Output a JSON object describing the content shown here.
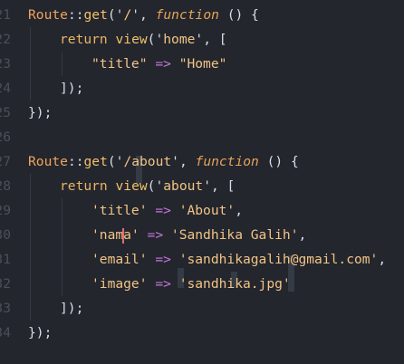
{
  "editor": {
    "lines": [
      {
        "number": "21",
        "tokens": [
          {
            "t": "Route",
            "c": "class"
          },
          {
            "t": "::",
            "c": "punc"
          },
          {
            "t": "get",
            "c": "fn"
          },
          {
            "t": "('",
            "c": "punc"
          },
          {
            "t": "/",
            "c": "str"
          },
          {
            "t": "', ",
            "c": "punc"
          },
          {
            "t": "function",
            "c": "kw"
          },
          {
            "t": " () {",
            "c": "punc"
          }
        ]
      },
      {
        "number": "22",
        "indent": 1,
        "tokens": [
          {
            "t": "return",
            "c": "ret"
          },
          {
            "t": " ",
            "c": "punc"
          },
          {
            "t": "view",
            "c": "fn"
          },
          {
            "t": "('",
            "c": "punc"
          },
          {
            "t": "home",
            "c": "str"
          },
          {
            "t": "', [",
            "c": "punc"
          }
        ]
      },
      {
        "number": "23",
        "indent": 2,
        "tokens": [
          {
            "t": "\"title\"",
            "c": "str"
          },
          {
            "t": " ",
            "c": "punc"
          },
          {
            "t": "=>",
            "c": "op"
          },
          {
            "t": " ",
            "c": "punc"
          },
          {
            "t": "\"Home\"",
            "c": "str"
          }
        ]
      },
      {
        "number": "24",
        "indent": 1,
        "tokens": [
          {
            "t": "]);",
            "c": "punc"
          }
        ]
      },
      {
        "number": "25",
        "tokens": [
          {
            "t": "});",
            "c": "punc"
          }
        ]
      },
      {
        "number": "26",
        "tokens": []
      },
      {
        "number": "27",
        "tokens": [
          {
            "t": "Route",
            "c": "class"
          },
          {
            "t": "::",
            "c": "punc"
          },
          {
            "t": "get",
            "c": "fn"
          },
          {
            "t": "('",
            "c": "punc"
          },
          {
            "t": "/about",
            "c": "str"
          },
          {
            "t": "', ",
            "c": "punc"
          },
          {
            "t": "function",
            "c": "kw"
          },
          {
            "t": " () {",
            "c": "punc"
          }
        ]
      },
      {
        "number": "28",
        "indent": 1,
        "tokens": [
          {
            "t": "return",
            "c": "ret"
          },
          {
            "t": " ",
            "c": "punc"
          },
          {
            "t": "view",
            "c": "fn"
          },
          {
            "t": "('",
            "c": "punc"
          },
          {
            "t": "about",
            "c": "str"
          },
          {
            "t": "', [",
            "c": "punc"
          }
        ]
      },
      {
        "number": "29",
        "indent": 2,
        "tokens": [
          {
            "t": "'title'",
            "c": "str"
          },
          {
            "t": " ",
            "c": "punc"
          },
          {
            "t": "=>",
            "c": "op"
          },
          {
            "t": " ",
            "c": "punc"
          },
          {
            "t": "'About'",
            "c": "str"
          },
          {
            "t": ",",
            "c": "punc"
          }
        ]
      },
      {
        "number": "30",
        "indent": 2,
        "cursorAfter": "'nam",
        "tokens": [
          {
            "t": "'nama'",
            "c": "str"
          },
          {
            "t": " ",
            "c": "punc"
          },
          {
            "t": "=>",
            "c": "op"
          },
          {
            "t": " ",
            "c": "punc"
          },
          {
            "t": "'Sandhika Galih'",
            "c": "str"
          },
          {
            "t": ",",
            "c": "punc"
          }
        ]
      },
      {
        "number": "31",
        "indent": 2,
        "tokens": [
          {
            "t": "'email'",
            "c": "str"
          },
          {
            "t": " ",
            "c": "punc"
          },
          {
            "t": "=>",
            "c": "op"
          },
          {
            "t": " ",
            "c": "punc"
          },
          {
            "t": "'sandhikagalih@gmail.com'",
            "c": "str"
          },
          {
            "t": ",",
            "c": "punc"
          }
        ]
      },
      {
        "number": "32",
        "indent": 2,
        "tokens": [
          {
            "t": "'image'",
            "c": "str"
          },
          {
            "t": " ",
            "c": "punc"
          },
          {
            "t": "=>",
            "c": "op"
          },
          {
            "t": " ",
            "c": "punc"
          },
          {
            "t": "'sandhika.jpg'",
            "c": "str"
          }
        ]
      },
      {
        "number": "33",
        "indent": 1,
        "tokens": [
          {
            "t": "]);",
            "c": "punc"
          }
        ]
      },
      {
        "number": "34",
        "tokens": [
          {
            "t": "});",
            "c": "punc"
          }
        ]
      }
    ],
    "colors": {
      "background": "#23262d",
      "gutter": "#4a4f59",
      "class": "#f0a45d",
      "function": "#f4c16a",
      "keyword": "#e5a35a",
      "string": "#f2c486",
      "operator": "#c678dd",
      "punctuation": "#d8dee9",
      "cursor": "#e06c75"
    }
  }
}
